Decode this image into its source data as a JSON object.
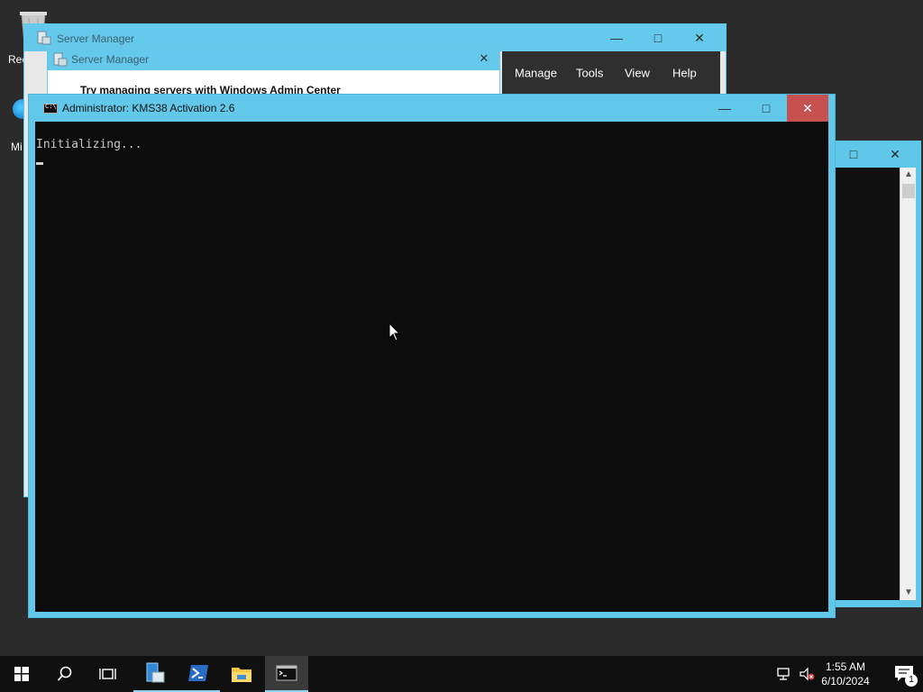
{
  "desktop": {
    "recycle_bin_label": "Rec",
    "edge_label": "Mi"
  },
  "server_manager": {
    "title": "Server Manager",
    "menu": [
      "Manage",
      "Tools",
      "View",
      "Help"
    ],
    "popup_title": "Server Manager",
    "popup_text": "Try managing servers with Windows Admin Center"
  },
  "cmd_window": {
    "title": "Administrator:  KMS38 Activation 2.6",
    "console_text": "Initializing..."
  },
  "taskbar": {
    "time": "1:55 AM",
    "date": "6/10/2024",
    "notification_count": "1"
  },
  "colors": {
    "title_accent": "#64c9ea",
    "close_hover": "#c75050",
    "console_bg": "#0c0c0c",
    "taskbar_bg": "#101010"
  }
}
